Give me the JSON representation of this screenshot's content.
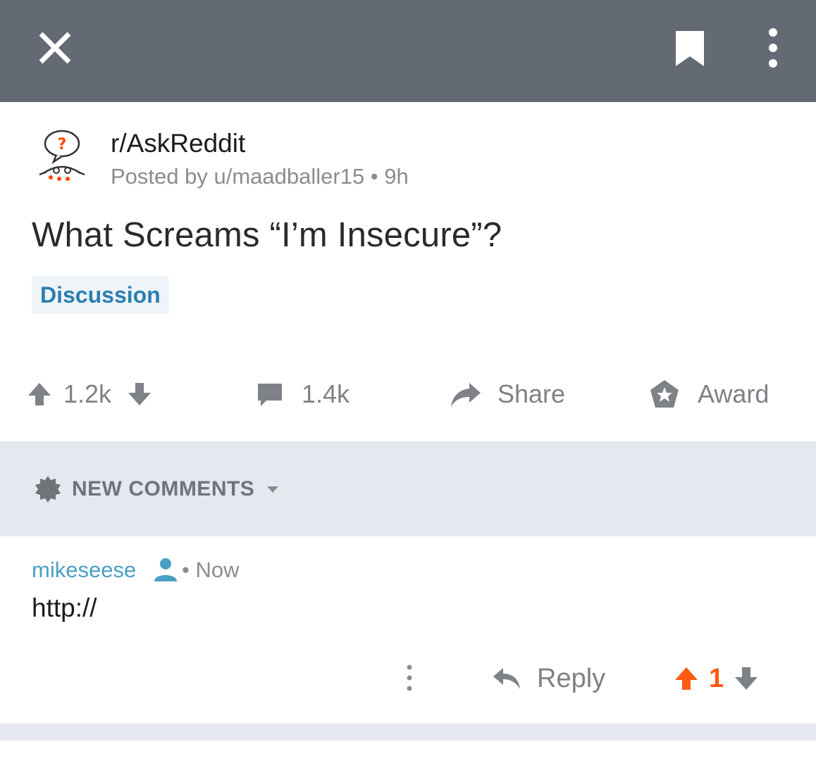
{
  "post": {
    "subreddit": "r/AskReddit",
    "posted_by": "Posted by u/maadballer15 • 9h",
    "title": "What Screams “I’m Insecure”?",
    "flair": "Discussion",
    "upvotes": "1.2k",
    "comments": "1.4k",
    "share_label": "Share",
    "award_label": "Award"
  },
  "sort": {
    "label": "NEW COMMENTS"
  },
  "comment": {
    "username": "mikeseese",
    "time": "• Now",
    "body": "http://",
    "reply_label": "Reply",
    "score": "1"
  },
  "colors": {
    "topbar": "#646a73",
    "upvote_active": "#ff5a12",
    "username": "#4a9fc6",
    "flair_text": "#2b7fb0"
  }
}
